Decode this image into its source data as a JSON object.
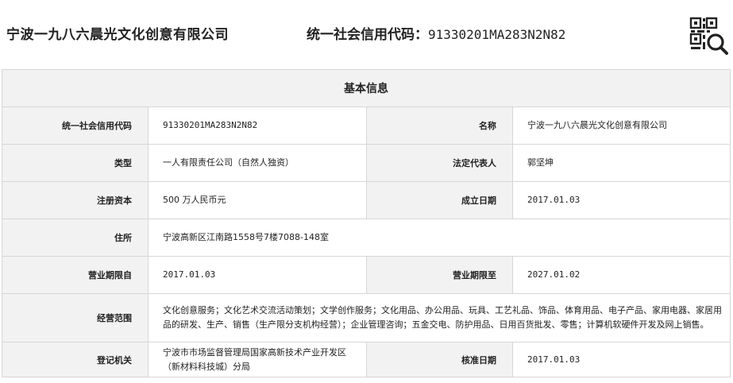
{
  "header": {
    "company_name": "宁波一九八六晨光文化创意有限公司",
    "credit_code_label": "统一社会信用代码：",
    "credit_code": "91330201MA283N2N82"
  },
  "table": {
    "caption": "基本信息",
    "rows": [
      {
        "l1": "统一社会信用代码",
        "v1": "91330201MA283N2N82",
        "l2": "名称",
        "v2": "宁波一九八六晨光文化创意有限公司"
      },
      {
        "l1": "类型",
        "v1": "一人有限责任公司（自然人独资）",
        "l2": "法定代表人",
        "v2": "郭坚坤"
      },
      {
        "l1": "注册资本",
        "v1": "500 万人民币元",
        "l2": "成立日期",
        "v2": "2017.01.03"
      },
      {
        "l1": "住所",
        "v1": "宁波高新区江南路1558号7楼7088-148室"
      },
      {
        "l1": "营业期限自",
        "v1": "2017.01.03",
        "l2": "营业期限至",
        "v2": "2027.01.02"
      },
      {
        "l1": "经营范围",
        "v1": "文化创意服务；文化艺术交流活动策划；文学创作服务；文化用品、办公用品、玩具、工艺礼品、饰品、体育用品、电子产品、家用电器、家居用品的研发、生产、销售（生产限分支机构经营）；企业管理咨询；五金交电、防护用品、日用百货批发、零售；计算机软硬件开发及网上销售。"
      },
      {
        "l1": "登记机关",
        "v1": "宁波市市场监督管理局国家高新技术产业开发区（新材料科技城）分局",
        "l2": "核准日期",
        "v2": "2017.01.03"
      }
    ]
  },
  "icons": {
    "qr_search": "qr-code-search-icon"
  }
}
